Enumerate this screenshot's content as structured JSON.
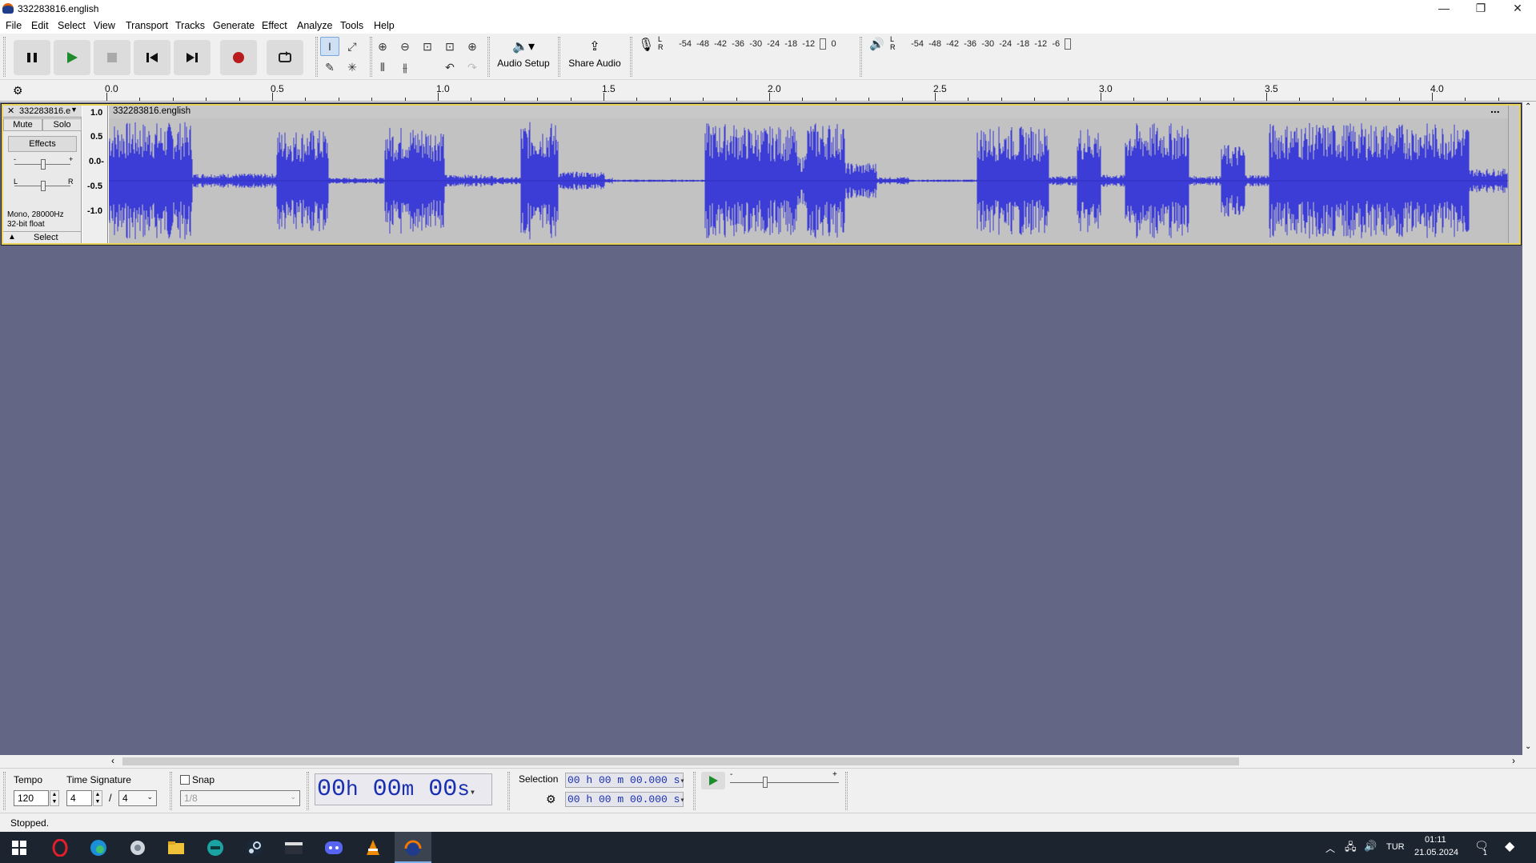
{
  "window": {
    "title": "332283816.english",
    "minimize": "—",
    "maximize": "❐",
    "close": "✕"
  },
  "menu": [
    "File",
    "Edit",
    "Select",
    "View",
    "Transport",
    "Tracks",
    "Generate",
    "Effect",
    "Analyze",
    "Tools",
    "Help"
  ],
  "toolbar": {
    "audio_setup_label": "Audio Setup",
    "share_audio_label": "Share Audio",
    "record_meter_ticks": [
      "-54",
      "-48",
      "-42",
      "-36",
      "-30",
      "-24",
      "-18",
      "-12",
      "",
      "0"
    ],
    "play_meter_ticks": [
      "-54",
      "-48",
      "-42",
      "-36",
      "-30",
      "-24",
      "-18",
      "-12",
      "-6",
      ""
    ],
    "meter_L": "L",
    "meter_R": "R"
  },
  "ruler": {
    "labels": [
      "0.0",
      "0.5",
      "1.0",
      "1.5",
      "2.0",
      "2.5",
      "3.0",
      "3.5",
      "4.0"
    ]
  },
  "track": {
    "name": "332283816.e",
    "clip_name": "332283816.english",
    "mute": "Mute",
    "solo": "Solo",
    "effects": "Effects",
    "gain_minus": "-",
    "gain_plus": "+",
    "pan_L": "L",
    "pan_R": "R",
    "info_line1": "Mono, 28000Hz",
    "info_line2": "32-bit float",
    "select": "Select",
    "scale": [
      "1.0",
      "0.5",
      "0.0-",
      "-0.5",
      "-1.0"
    ],
    "menu_dots": "..."
  },
  "bottom": {
    "tempo_label": "Tempo",
    "tempo_value": "120",
    "time_sig_label": "Time Signature",
    "time_sig_num": "4",
    "time_sig_sep": "/",
    "time_sig_den": "4",
    "snap_label": "Snap",
    "snap_value": "1/8",
    "time_hh": "00",
    "time_h": "h",
    "time_mm": "00",
    "time_m": "m",
    "time_ss": "00",
    "time_s": "s",
    "selection_label": "Selection",
    "sel_start": "00 h 00 m 00.000 s",
    "sel_end": "00 h 00 m 00.000 s",
    "speed_minus": "-",
    "speed_plus": "+"
  },
  "status": {
    "text": "Stopped."
  },
  "taskbar": {
    "lang": "TUR",
    "time": "01:11",
    "date": "21.05.2024",
    "notif_count": "1"
  },
  "colors": {
    "wave": "#3c3cd6",
    "wave_bg": "#c2c2c2",
    "track_area": "#646686",
    "record": "#b81c1c",
    "selection_border": "#e8d45a"
  }
}
